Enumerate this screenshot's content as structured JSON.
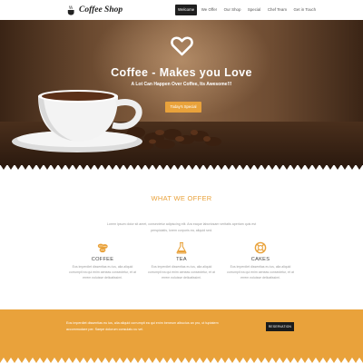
{
  "brand": {
    "name": "Coffee Shop",
    "icon": "coffee-cup-icon"
  },
  "nav": {
    "items": [
      {
        "label": "Welcome",
        "active": true
      },
      {
        "label": "We Offer",
        "active": false
      },
      {
        "label": "Our Shop",
        "active": false
      },
      {
        "label": "Special",
        "active": false
      },
      {
        "label": "Chef Team",
        "active": false
      },
      {
        "label": "Get in Touch",
        "active": false
      }
    ]
  },
  "hero": {
    "icon": "heart-icon",
    "title": "Coffee - Makes you Love",
    "subtitle": "A Lot Can Happen Over Coffee, Its Awesome!!!",
    "button": "Today's Special"
  },
  "offer": {
    "title": "WHAT WE OFFER",
    "text": "Lorem ipsum dolor sit amet, consectetur adipiscing elit. Ara eaque laboriosam veritatis aperiam quis est perspiciatis, lorem corporis ea, aliquid sed.",
    "features": [
      {
        "icon": "coffee-beans-icon",
        "title": "COFFEE",
        "text": "Eos imperdiet dissentias eu ius, alia aliquid corrumpit ea qui enim aeneas consectetur, et at errem noluisse delicatissimi."
      },
      {
        "icon": "flask-icon",
        "title": "TEA",
        "text": "Eos imperdiet dissentias eu ius, alia aliquid corrumpit ea qui enim aeneas consectetur, et at errem noluisse delicatissimi."
      },
      {
        "icon": "lifebuoy-icon",
        "title": "CAKES",
        "text": "Eos imperdiet dissentias eu ius, alia aliquid corrumpit ea qui enim aeneas consectetur, et at errem noluisse delicatissimi."
      }
    ]
  },
  "band": {
    "text": "Eos imperdiet dissentias eu ius, alia aliquid corrumpit ea qui enim beneum albucius an pro, ut tuptatem accommodare per. Saepe dolorum consulatu cu vel.",
    "button": "RESERVATION"
  },
  "colors": {
    "accent": "#e9a23b",
    "dark": "#1f1f1f",
    "text": "#555555",
    "muted": "#9a9a9a"
  }
}
